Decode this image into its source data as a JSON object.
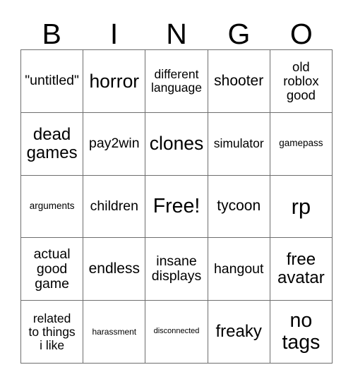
{
  "card": {
    "type": "bingo-card",
    "title_letters": [
      "B",
      "I",
      "N",
      "G",
      "O"
    ],
    "columns": 5,
    "rows": 5,
    "free_space": {
      "row": 2,
      "column": 2,
      "label": "Free!"
    },
    "colors": {
      "background": "#ffffff",
      "text": "#000000",
      "grid_line": "#6e6e6e"
    },
    "cells": [
      [
        {
          "text": "\"untitled\"",
          "size": "fs-19"
        },
        {
          "text": "horror",
          "size": "fs-26"
        },
        {
          "text": "different\nlanguage",
          "size": "fs-17"
        },
        {
          "text": "shooter",
          "size": "fs-21"
        },
        {
          "text": "old\nroblox\ngood",
          "size": "fs-18"
        }
      ],
      [
        {
          "text": "dead\ngames",
          "size": "fs-24"
        },
        {
          "text": "pay2win",
          "size": "fs-19"
        },
        {
          "text": "clones",
          "size": "fs-26"
        },
        {
          "text": "simulator",
          "size": "fs-17"
        },
        {
          "text": "gamepass",
          "size": "fs-13"
        }
      ],
      [
        {
          "text": "arguments",
          "size": "fs-13"
        },
        {
          "text": "children",
          "size": "fs-19"
        },
        {
          "text": "Free!",
          "size": "fs-28"
        },
        {
          "text": "tycoon",
          "size": "fs-21"
        },
        {
          "text": "rp",
          "size": "fs-30"
        }
      ],
      [
        {
          "text": "actual\ngood\ngame",
          "size": "fs-19"
        },
        {
          "text": "endless",
          "size": "fs-21"
        },
        {
          "text": "insane\ndisplays",
          "size": "fs-19"
        },
        {
          "text": "hangout",
          "size": "fs-19"
        },
        {
          "text": "free\navatar",
          "size": "fs-24"
        }
      ],
      [
        {
          "text": "related\nto things\ni like",
          "size": "fs-17"
        },
        {
          "text": "harassment",
          "size": "fs-12"
        },
        {
          "text": "disconnected",
          "size": "fs-11"
        },
        {
          "text": "freaky",
          "size": "fs-24"
        },
        {
          "text": "no\ntags",
          "size": "fs-28"
        }
      ]
    ]
  }
}
